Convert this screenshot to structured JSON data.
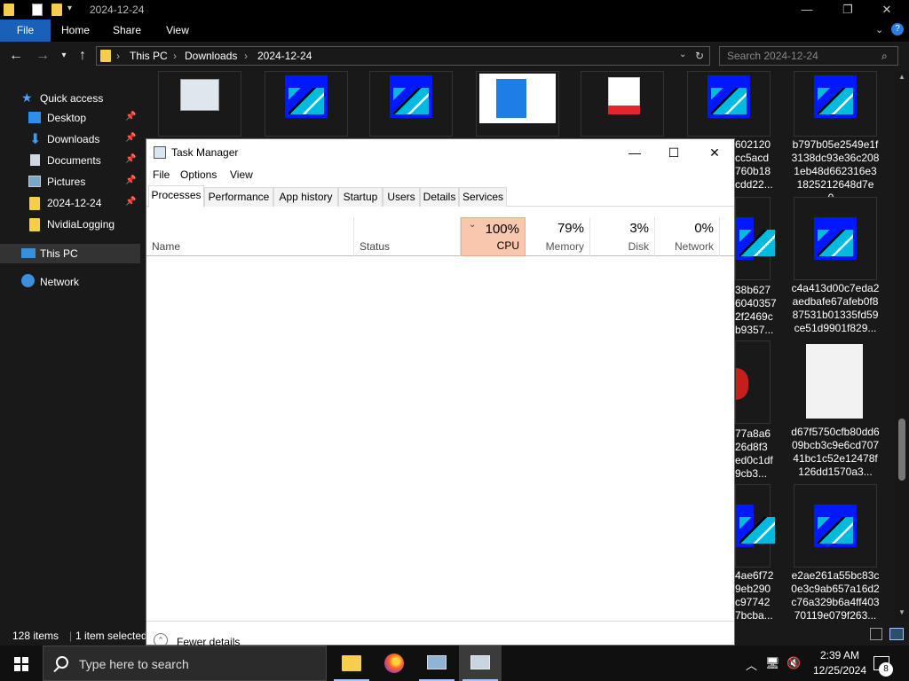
{
  "explorer": {
    "window_title": "2024-12-24",
    "ribbon_tabs": [
      "File",
      "Home",
      "Share",
      "View"
    ],
    "breadcrumb": [
      "This PC",
      "Downloads",
      "2024-12-24"
    ],
    "search_placeholder": "Search 2024-12-24",
    "nav": {
      "quick_access": "Quick access",
      "items": [
        "Desktop",
        "Downloads",
        "Documents",
        "Pictures",
        "2024-12-24",
        "NvidiaLogging"
      ],
      "this_pc": "This PC",
      "network": "Network"
    },
    "files": [
      "b797b05e2549e1f3138dc93e36c2081eb48d662316e31825212648d7e0...",
      "c4a413d00c7eda2aedbafe67afeb0f887531b01335fd59ce51d9901f829...",
      "d67f5750cfb80dd609bcb3c9e6cd70741bc1c52e12478f126dd1570a3...",
      "e2ae261a55bc83c0e3c9ab657a16d2c76a329b6a4ff40370119e079f263..."
    ],
    "partial_files": [
      "602120\ncc5acd\n760b18\ncdd22...",
      "38b627\n6040357\n2f2469c\nb9357...",
      "77a8a6\n26d8f3\ned0c1df\n9cb3...",
      "4ae6f72\n9eb290\nc97742\n7bcba..."
    ],
    "status_count": "128 items",
    "status_selected": "1 item selected"
  },
  "taskmgr": {
    "title": "Task Manager",
    "menu": [
      "File",
      "Options",
      "View"
    ],
    "tabs": [
      "Processes",
      "Performance",
      "App history",
      "Startup",
      "Users",
      "Details",
      "Services"
    ],
    "columns": {
      "name": "Name",
      "status": "Status",
      "cpu": {
        "pct": "100%",
        "label": "CPU"
      },
      "memory": {
        "pct": "79%",
        "label": "Memory"
      },
      "disk": {
        "pct": "3%",
        "label": "Disk"
      },
      "network": {
        "pct": "0%",
        "label": "Network"
      }
    },
    "fewer_details": "Fewer details"
  },
  "taskbar": {
    "search_text": "Type here to search",
    "time": "2:39 AM",
    "date": "12/25/2024",
    "notification_count": "8"
  },
  "colors": {
    "cpu_highlight": "#f9c7ae",
    "accent": "#1860b8",
    "folder": "#f6cd4c"
  }
}
